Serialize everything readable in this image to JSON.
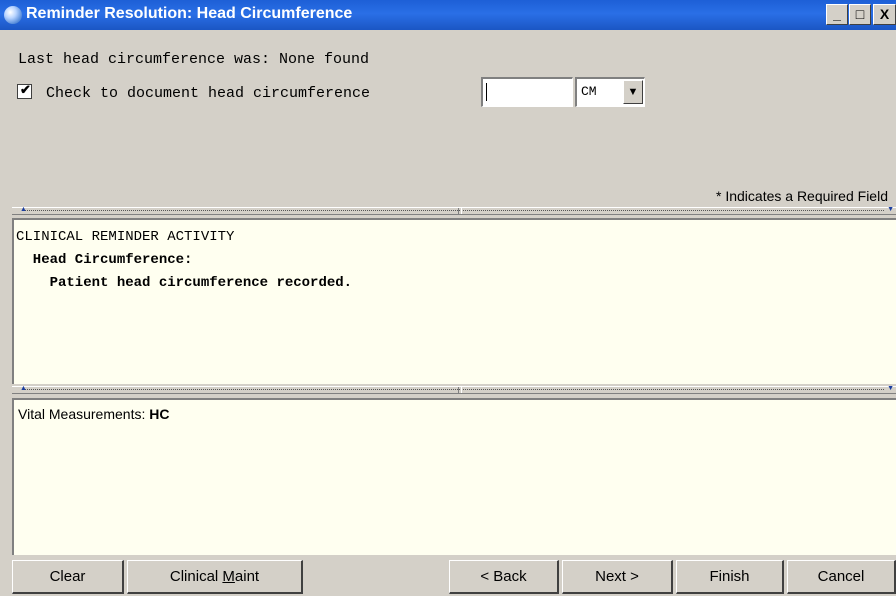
{
  "window": {
    "title": "Reminder Resolution: Head Circumference",
    "controls": {
      "minimize": "_",
      "maximize": "□",
      "close": "X"
    }
  },
  "form": {
    "last_value_text": "Last head circumference was: None found",
    "checkbox_label": "Check to document head circumference",
    "checkbox_checked": true,
    "hc_value": "",
    "unit_selected": "CM",
    "required_note": "* Indicates a Required Field"
  },
  "activity_pane": {
    "line1": "CLINICAL REMINDER ACTIVITY",
    "line2": "  Head Circumference:",
    "line3": "    Patient head circumference recorded."
  },
  "vitals_pane": {
    "label": "Vital Measurements: ",
    "value": "HC"
  },
  "buttons": {
    "clear": "Clear",
    "clinical_maint_prefix": "Clinical ",
    "clinical_maint_underlined": "M",
    "clinical_maint_suffix": "aint",
    "back": "< Back",
    "next": "Next >",
    "finish": "Finish",
    "cancel": "Cancel"
  },
  "icons": {
    "title_icon": "app-globe-icon",
    "dropdown_icon": "dropdown-arrow-icon"
  }
}
